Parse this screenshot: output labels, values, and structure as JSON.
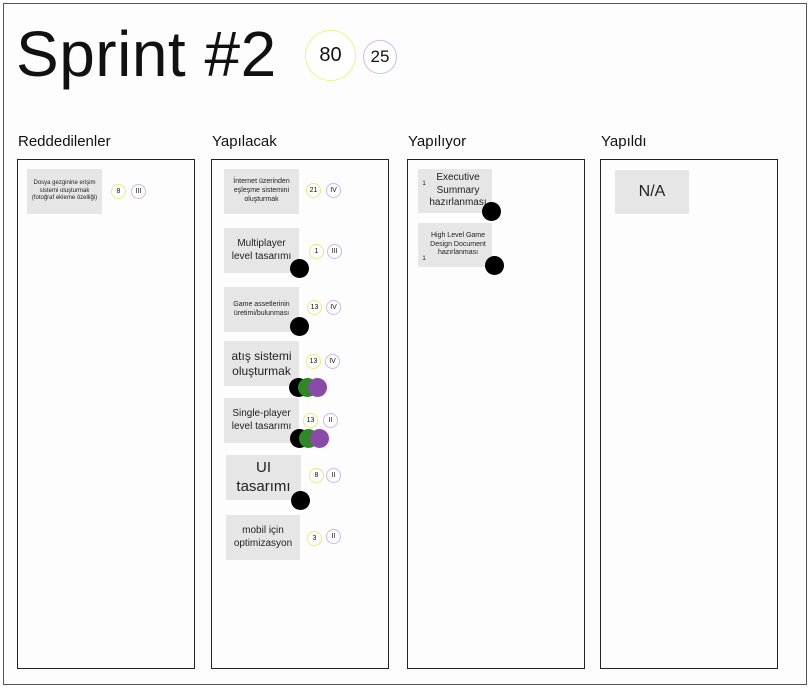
{
  "sprint": {
    "title": "Sprint #2",
    "total_points": "80",
    "total_tasks": "25"
  },
  "columns": [
    {
      "title": "Reddedilenler"
    },
    {
      "title": "Yapılacak"
    },
    {
      "title": "Yapılıyor"
    },
    {
      "title": "Yapıldı"
    }
  ],
  "cards": {
    "rejected": [
      {
        "label": "Dosya gezginine erişim sistemi oluşturmak (fotoğraf ekleme özelliği)",
        "points": "8",
        "priority": "III"
      }
    ],
    "todo": [
      {
        "label": "İnternet üzerinden eşleşme sistemini oluşturmak",
        "points": "21",
        "priority": "IV"
      },
      {
        "label": "Multiplayer level tasarımı",
        "points": "1",
        "priority": "III"
      },
      {
        "label": "Game assetlerinin üretimi/bulunması",
        "points": "13",
        "priority": "IV"
      },
      {
        "label": "atış sistemi oluşturmak",
        "points": "13",
        "priority": "IV"
      },
      {
        "label": "Single-player level tasarımı",
        "points": "13",
        "priority": "II"
      },
      {
        "label": "UI tasarımı",
        "points": "8",
        "priority": "II"
      },
      {
        "label": "mobil için optimizasyon",
        "points": "3",
        "priority": "II"
      }
    ],
    "in_progress": [
      {
        "label": "Executive Summary hazırlanması",
        "points": "1"
      },
      {
        "label": "High Level Game Design Document hazırlanması",
        "points": "1"
      }
    ],
    "done": [
      {
        "label": "N/A"
      }
    ]
  },
  "colors": {
    "assignee_black": "#000000",
    "assignee_green": "#2d8a22",
    "assignee_purple": "#8a4aa8",
    "points_ring": "#ecea7a",
    "priority_ring": "#d2b4ea"
  }
}
